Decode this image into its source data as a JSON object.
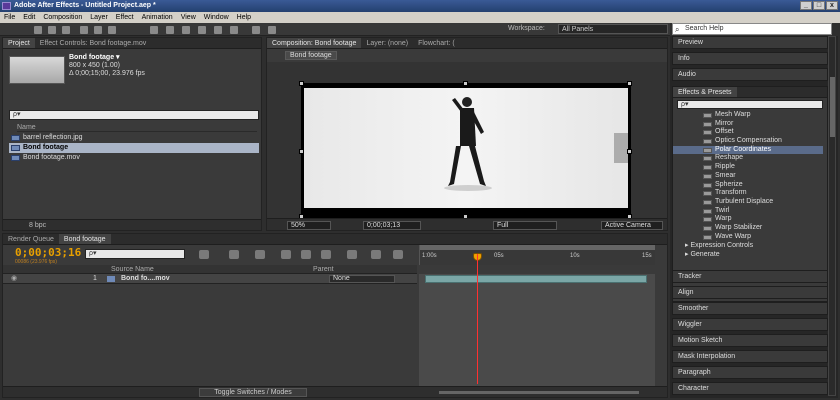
{
  "window": {
    "title": "Adobe After Effects - Untitled Project.aep *",
    "controls": [
      "_",
      "□",
      "x"
    ]
  },
  "menu": [
    "File",
    "Edit",
    "Composition",
    "Layer",
    "Effect",
    "Animation",
    "View",
    "Window",
    "Help"
  ],
  "toolbar": {
    "workspace_label": "Workspace:",
    "workspace_value": "All Panels"
  },
  "search_help": {
    "placeholder": "Search Help"
  },
  "project_panel": {
    "tabs": [
      "Project",
      "Effect Controls: Bond footage.mov",
      "Composition: Bond footage",
      "Layer: (none)",
      "Flowchart: ("
    ],
    "item": {
      "name": "Bond footage ▾",
      "size": "800 x 450 (1.00)",
      "duration": "Δ 0;00;15;00, 23.976 fps"
    },
    "search": "ρ▾",
    "column_name": "Name",
    "files": [
      {
        "name": "barrel reflection.jpg",
        "selected": false
      },
      {
        "name": "Bond footage",
        "selected": true
      },
      {
        "name": "Bond footage.mov",
        "selected": false
      }
    ],
    "bpc": "8 bpc"
  },
  "composition_panel": {
    "breadcrumb": "Bond footage",
    "zoom": "50%",
    "timecode": "0;00;03;13",
    "resolution": "Full",
    "view": "Active Camera"
  },
  "right_panels": {
    "top": [
      "Preview",
      "Info",
      "Audio"
    ],
    "effects_title": "Effects & Presets",
    "effects_search": "ρ▾",
    "effects": [
      "Mesh Warp",
      "Mirror",
      "Offset",
      "Optics Compensation",
      "Polar Coordinates",
      "Reshape",
      "Ripple",
      "Smear",
      "Spherize",
      "Transform",
      "Turbulent Displace",
      "Twirl",
      "Warp",
      "Warp Stabilizer",
      "Wave Warp"
    ],
    "selected_effect": "Polar Coordinates",
    "folders": [
      "Expression Controls",
      "Generate"
    ],
    "bottom": [
      "Tracker",
      "Align",
      "Smoother",
      "Wiggler",
      "Motion Sketch",
      "Mask Interpolation",
      "Paragraph",
      "Character"
    ]
  },
  "timeline": {
    "tabs": [
      "Render Queue",
      "Bond footage"
    ],
    "timecode": "0;00;03;16",
    "fps": "00086 (23.976 fps)",
    "search": "ρ▾",
    "ruler": [
      "1:00s",
      "05s",
      "10s",
      "15s"
    ],
    "columns": {
      "source": "Source Name",
      "parent": "Parent"
    },
    "layer": {
      "number": "1",
      "name": "Bond fo....mov",
      "parent": "None"
    },
    "toggle_label": "Toggle Switches / Modes"
  }
}
